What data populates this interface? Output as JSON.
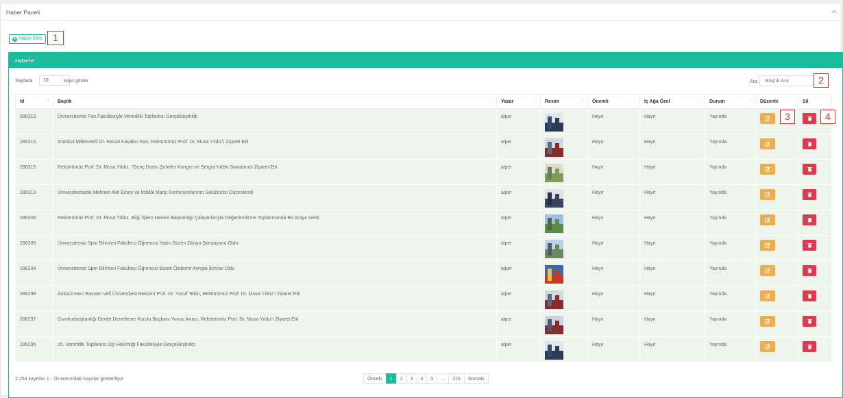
{
  "panel": {
    "title": "Haber Paneli"
  },
  "add_button": {
    "label": "Haber Ekle"
  },
  "annotations": [
    "1",
    "2",
    "3",
    "4"
  ],
  "box": {
    "title": "Haberler"
  },
  "length": {
    "before": "Sayfada",
    "value": "10",
    "after": "kayıt göster"
  },
  "search": {
    "label": "Ara:",
    "placeholder": "Başlık Ara"
  },
  "columns": [
    "Id",
    "Başlık",
    "Yazar",
    "Resim",
    "Önemli",
    "İç Ağa Özel",
    "Durum",
    "Düzenle",
    "Sil"
  ],
  "rows": [
    {
      "id": "286319",
      "title": "Üniversitemiz Fen Fakültesiyle Verimlilik Toplantısı Gerçekleştirildi",
      "author": "alper",
      "important": "Hayır",
      "internal": "Hayır",
      "status": "Yayında"
    },
    {
      "id": "286316",
      "title": "İstanbul Milletvekili Dr. Ravza Kavakcı Kan, Rektörümüz Prof. Dr. Musa Yıldız'ı Ziyaret Etti",
      "author": "alper",
      "important": "Hayır",
      "internal": "Hayır",
      "status": "Yayında"
    },
    {
      "id": "286315",
      "title": "Rektörümüz Prof. Dr. Musa Yıldız, \"Genç Dostu Şehirler Kongre ve Sergisi\"ndeki Standımızı Ziyaret Etti",
      "author": "alper",
      "important": "Hayır",
      "internal": "Hayır",
      "status": "Yayında"
    },
    {
      "id": "286313",
      "title": "Üniversitemizde Mehmet Akif Ersoy ve İstiklâl Marşı Konferanslarının Sekizincisi Düzenlendi",
      "author": "alper",
      "important": "Hayır",
      "internal": "Hayır",
      "status": "Yayında"
    },
    {
      "id": "286306",
      "title": "Rektörümüz Prof. Dr. Musa Yıldız, Bilgi İşlem Dairesi Başkanlığı Çalışanlarıyla Değerlendirme Toplantısında Bir Araya Geldi",
      "author": "alper",
      "important": "Hayır",
      "internal": "Hayır",
      "status": "Yayında"
    },
    {
      "id": "286305",
      "title": "Üniversitemiz Spor Bilimleri Fakültesi Öğrencisi Yasin Süzen Dünya Şampiyonu Oldu",
      "author": "alper",
      "important": "Hayır",
      "internal": "Hayır",
      "status": "Yayında"
    },
    {
      "id": "286304",
      "title": "Üniversitemiz Spor Bilimleri Fakültesi Öğrencisi Burak Özdemir Avrupa İkincisi Oldu",
      "author": "alper",
      "important": "Hayır",
      "internal": "Hayır",
      "status": "Yayında"
    },
    {
      "id": "286298",
      "title": "Ankara Hacı Bayram Veli Üniversitesi Rektörü Prof. Dr. Yusuf Tekin, Rektörümüz Prof. Dr. Musa Yıldız'ı Ziyaret Etti",
      "author": "alper",
      "important": "Hayır",
      "internal": "Hayır",
      "status": "Yayında"
    },
    {
      "id": "286297",
      "title": "Cumhurbaşkanlığı Devlet Denetleme Kurulu Başkanı Yunus Arıncı, Rektörümüz Prof. Dr. Musa Yıldız'ı Ziyaret Etti",
      "author": "alper",
      "important": "Hayır",
      "internal": "Hayır",
      "status": "Yayında"
    },
    {
      "id": "286296",
      "title": "15. Verimlilik Toplantısı Diş Hekimliği Fakültesiyle Gerçekleştirildi",
      "author": "alper",
      "important": "Hayır",
      "internal": "Hayır",
      "status": "Yayında"
    }
  ],
  "info": "2.254 kayıttan 1 - 10 arasındaki kayıtlar gösteriliyor",
  "pagination": [
    "Önceki",
    "1",
    "2",
    "3",
    "4",
    "5",
    "...",
    "226",
    "Sonraki"
  ],
  "colors": {
    "accent": "#1abc9c",
    "edit": "#f0ad4e",
    "delete": "#e0384c",
    "annotation": "#d0312d"
  }
}
